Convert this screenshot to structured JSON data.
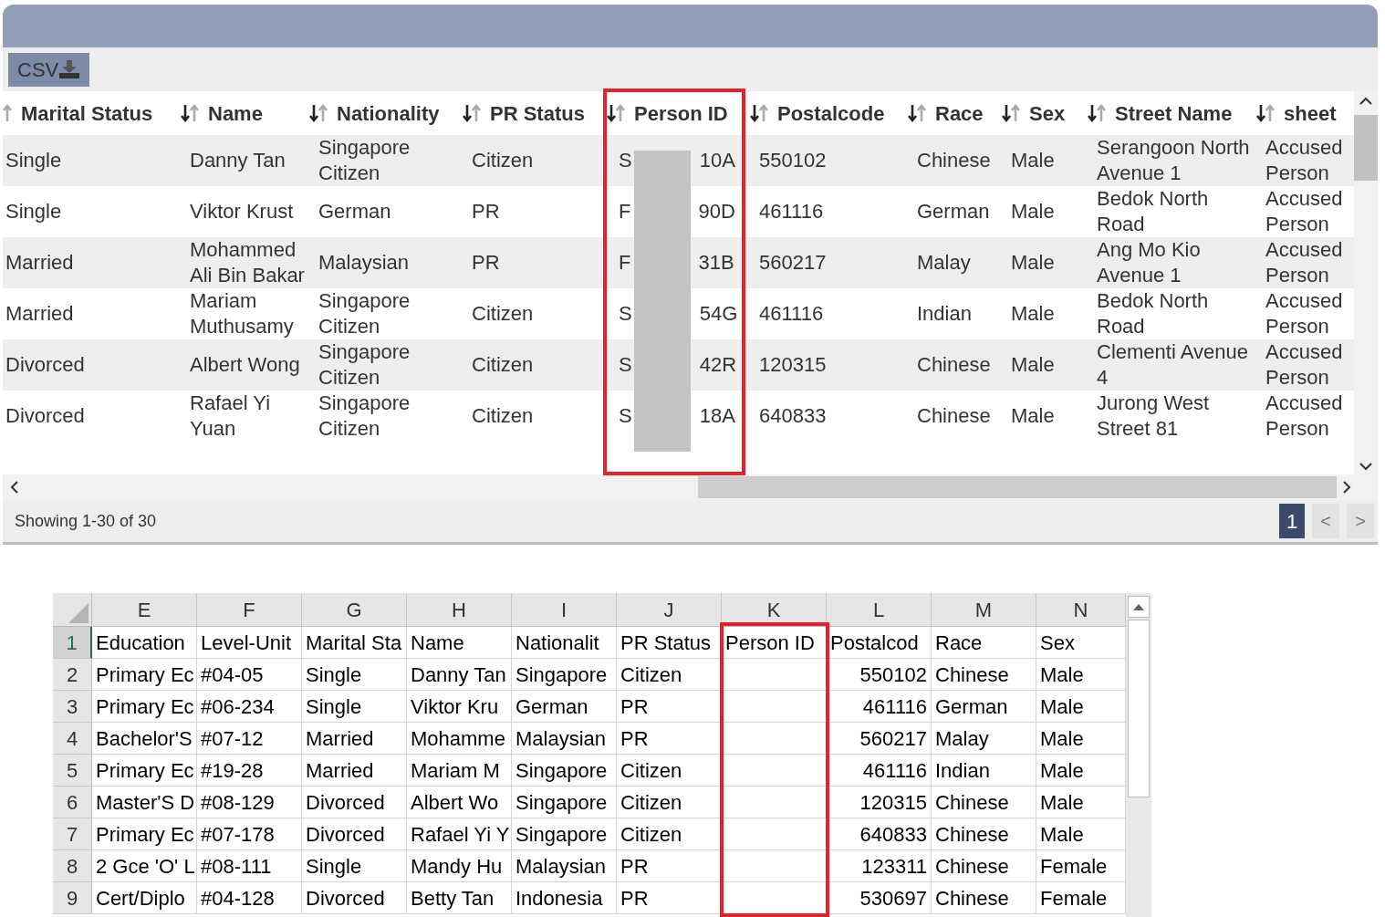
{
  "web_table": {
    "export_button": "CSV",
    "columns": [
      "Marital Status",
      "Name",
      "Nationality",
      "PR Status",
      "Person ID",
      "Postalcode",
      "Race",
      "Sex",
      "Street Name",
      "sheet"
    ],
    "rows": [
      {
        "cells": [
          "Single",
          "Danny Tan",
          "Singapore Citizen",
          "Citizen",
          {
            "kind": "redacted",
            "before": "S",
            "after": "10A"
          },
          "550102",
          "Chinese",
          "Male",
          "Serangoon North Avenue 1",
          "Accused Person"
        ]
      },
      {
        "cells": [
          "Single",
          "Viktor Krust",
          "German",
          "PR",
          {
            "kind": "redacted",
            "before": "F",
            "after": "90D"
          },
          "461116",
          "German",
          "Male",
          "Bedok North Road",
          "Accused Person"
        ]
      },
      {
        "cells": [
          "Married",
          "Mohammed Ali Bin Bakar",
          "Malaysian",
          "PR",
          {
            "kind": "redacted",
            "before": "F",
            "after": "31B"
          },
          "560217",
          "Malay",
          "Male",
          "Ang Mo Kio Avenue 1",
          "Accused Person"
        ]
      },
      {
        "cells": [
          "Married",
          "Mariam Muthusamy",
          "Singapore Citizen",
          "Citizen",
          {
            "kind": "redacted",
            "before": "S",
            "after": "54G"
          },
          "461116",
          "Indian",
          "Male",
          "Bedok North Road",
          "Accused Person"
        ]
      },
      {
        "cells": [
          "Divorced",
          "Albert Wong",
          "Singapore Citizen",
          "Citizen",
          {
            "kind": "redacted",
            "before": "S",
            "after": "42R"
          },
          "120315",
          "Chinese",
          "Male",
          "Clementi Avenue 4",
          "Accused Person"
        ]
      },
      {
        "cells": [
          "Divorced",
          "Rafael Yi Yuan",
          "Singapore Citizen",
          "Citizen",
          {
            "kind": "redacted",
            "before": "S",
            "after": "18A"
          },
          "640833",
          "Chinese",
          "Male",
          "Jurong West Street 81",
          "Accused Person"
        ]
      }
    ],
    "footer": "Showing 1-30 of 30",
    "pagination": {
      "pages": [
        {
          "label": "1",
          "selected": true
        }
      ],
      "prev": {
        "label": "<",
        "disabled": true
      },
      "next": {
        "label": ">",
        "disabled": true
      }
    }
  },
  "spreadsheet": {
    "column_letters": [
      "E",
      "F",
      "G",
      "H",
      "I",
      "J",
      "K",
      "L",
      "M",
      "N"
    ],
    "rows": [
      {
        "number": "1",
        "selected": true,
        "cells": [
          "Education",
          "Level-Unit",
          "Marital Sta",
          "Name",
          "Nationalit",
          "PR Status",
          "Person ID",
          "Postalcod",
          "Race",
          "Sex"
        ]
      },
      {
        "number": "2",
        "selected": false,
        "cells": [
          "Primary Ec",
          "#04-05",
          "Single",
          "Danny Tan",
          "Singapore",
          "Citizen",
          "",
          "550102",
          "Chinese",
          "Male"
        ]
      },
      {
        "number": "3",
        "selected": false,
        "cells": [
          "Primary Ec",
          "#06-234",
          "Single",
          "Viktor Kru",
          "German",
          "PR",
          "",
          "461116",
          "German",
          "Male"
        ]
      },
      {
        "number": "4",
        "selected": false,
        "cells": [
          "Bachelor'S",
          "#07-12",
          "Married",
          "Mohamme",
          "Malaysian",
          "PR",
          "",
          "560217",
          "Malay",
          "Male"
        ]
      },
      {
        "number": "5",
        "selected": false,
        "cells": [
          "Primary Ec",
          "#19-28",
          "Married",
          "Mariam M",
          "Singapore",
          "Citizen",
          "",
          "461116",
          "Indian",
          "Male"
        ]
      },
      {
        "number": "6",
        "selected": false,
        "cells": [
          "Master'S D",
          "#08-129",
          "Divorced",
          "Albert Wo",
          "Singapore",
          "Citizen",
          "",
          "120315",
          "Chinese",
          "Male"
        ]
      },
      {
        "number": "7",
        "selected": false,
        "cells": [
          "Primary Ec",
          "#07-178",
          "Divorced",
          "Rafael Yi Y",
          "Singapore",
          "Citizen",
          "",
          "640833",
          "Chinese",
          "Male"
        ]
      },
      {
        "number": "8",
        "selected": false,
        "cells": [
          "2 Gce 'O' L",
          "#08-111",
          "Single",
          "Mandy Hu",
          "Malaysian",
          "PR",
          "",
          "123311",
          "Chinese",
          "Female"
        ]
      },
      {
        "number": "9",
        "selected": false,
        "cells": [
          "Cert/Diplo",
          "#04-128",
          "Divorced",
          "Betty Tan",
          "Indonesia",
          "PR",
          "",
          "530697",
          "Chinese",
          "Female"
        ]
      }
    ]
  }
}
